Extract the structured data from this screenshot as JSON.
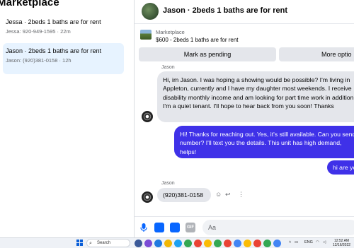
{
  "sidebar": {
    "title": "Marketplace",
    "chats": [
      {
        "title": "Jessa · 2beds 1 baths are for rent",
        "subtitle": "Jessa: 920-949-1595 · 22m"
      },
      {
        "title": "Jason · 2beds 1 baths are for rent",
        "subtitle": "Jason: (920)381-0158 · 12h"
      }
    ]
  },
  "conversation": {
    "header_title": "Jason · 2beds 1 baths are for rent",
    "marketplace_label": "Marketplace",
    "listing_text": "$600 - 2beds 1 baths are for rent",
    "mark_pending_label": "Mark as pending",
    "more_options_label": "More optio",
    "top_sender_label": "Jason",
    "messages": [
      {
        "from": "Jason",
        "text": "Hi, im Jason. I was hoping a showing would be possible? I'm living in Appleton, currently and I have my daughter most weekends. I receive disability monthly income and am looking for part time work in addition. I'm a quiet tenant. I'll hope to hear back from you soon! Thanks"
      },
      {
        "from": "me",
        "text": "Hi! Thanks for reaching out. Yes, it's still available. Can you send number? I'll text you the details. This unit has high demand, helps!"
      },
      {
        "from": "me",
        "text": "hi are yo"
      },
      {
        "from": "Jason",
        "sender_label": "Jason",
        "text": "(920)381-0158"
      }
    ],
    "composer_placeholder": "Aa",
    "composer_gif": "GIF"
  },
  "taskbar": {
    "search_label": "Search",
    "language": "ENG",
    "clock_time": "12:52 AM",
    "clock_date": "12/16/2022"
  },
  "colors": {
    "accent": "#0866ff",
    "outgoing_bubble": "#3f31e8",
    "incoming_bubble": "#e4e6eb",
    "active_chat": "#e7f3ff"
  }
}
